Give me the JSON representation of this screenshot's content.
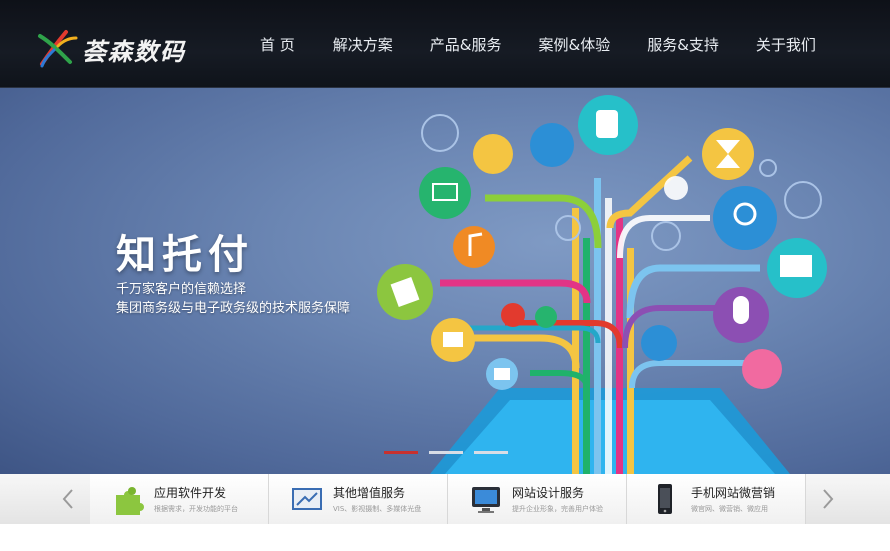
{
  "brand": {
    "name": "荟森数码"
  },
  "nav": [
    {
      "label": "首 页"
    },
    {
      "label": "解决方案"
    },
    {
      "label": "产品&服务"
    },
    {
      "label": "案例&体验"
    },
    {
      "label": "服务&支持"
    },
    {
      "label": "关于我们"
    }
  ],
  "hero": {
    "title": "知托付",
    "line1": "千万家客户的信赖选择",
    "line2": "集团商务级与电子政务级的技术服务保障",
    "slides": 3,
    "active_slide": 1
  },
  "services": [
    {
      "title": "应用软件开发",
      "sub": "根据需求，开发功能的平台",
      "icon": "puzzle-icon"
    },
    {
      "title": "其他增值服务",
      "sub": "VIS、影视摄制、多媒体光盘",
      "icon": "presentation-icon"
    },
    {
      "title": "网站设计服务",
      "sub": "提升企业形象，完善用户体验",
      "icon": "monitor-icon"
    },
    {
      "title": "手机网站微营销",
      "sub": "微官网、微营销、微应用",
      "icon": "phone-icon"
    }
  ],
  "colors": {
    "header_bg": "#131821",
    "banner_bg": "#6b86b3",
    "active_dot": "#c8312e"
  }
}
